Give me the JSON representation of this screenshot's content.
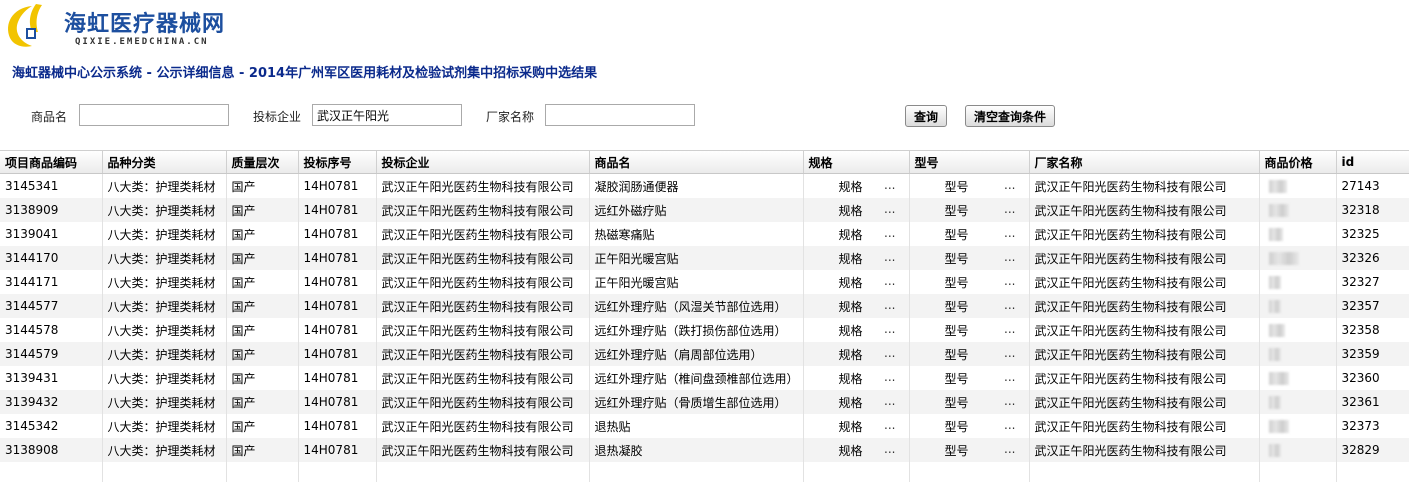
{
  "brand": {
    "name": "海虹医疗器械网",
    "domain": "QIXIE.EMEDCHINA.CN"
  },
  "title": "海虹器械中心公示系统 - 公示详细信息 - 2014年广州军区医用耗材及检验试剂集中招标采购中选结果",
  "search": {
    "product_label": "商品名",
    "product_value": "",
    "bidder_label": "投标企业",
    "bidder_value": "武汉正午阳光",
    "maker_label": "厂家名称",
    "maker_value": "",
    "query_button": "查询",
    "clear_button": "清空查询条件"
  },
  "columns": [
    "项目商品编码",
    "品种分类",
    "质量层次",
    "投标序号",
    "投标企业",
    "商品名",
    "规格",
    "型号",
    "厂家名称",
    "商品价格",
    "id"
  ],
  "spec_label": "规格",
  "model_label": "型号",
  "ellipsis": "...",
  "rows": [
    {
      "code": "3145341",
      "category": "八大类：护理类耗材",
      "quality": "国产",
      "bid_no": "14H0781",
      "bidder": "武汉正午阳光医药生物科技有限公司",
      "product": "凝胶润肠通便器",
      "maker": "武汉正午阳光医药生物科技有限公司",
      "id": "27143"
    },
    {
      "code": "3138909",
      "category": "八大类：护理类耗材",
      "quality": "国产",
      "bid_no": "14H0781",
      "bidder": "武汉正午阳光医药生物科技有限公司",
      "product": "远红外磁疗贴",
      "maker": "武汉正午阳光医药生物科技有限公司",
      "id": "32318"
    },
    {
      "code": "3139041",
      "category": "八大类：护理类耗材",
      "quality": "国产",
      "bid_no": "14H0781",
      "bidder": "武汉正午阳光医药生物科技有限公司",
      "product": "热磁寒痛贴",
      "maker": "武汉正午阳光医药生物科技有限公司",
      "id": "32325"
    },
    {
      "code": "3144170",
      "category": "八大类：护理类耗材",
      "quality": "国产",
      "bid_no": "14H0781",
      "bidder": "武汉正午阳光医药生物科技有限公司",
      "product": "正午阳光暖宫贴",
      "maker": "武汉正午阳光医药生物科技有限公司",
      "id": "32326"
    },
    {
      "code": "3144171",
      "category": "八大类：护理类耗材",
      "quality": "国产",
      "bid_no": "14H0781",
      "bidder": "武汉正午阳光医药生物科技有限公司",
      "product": "正午阳光暖宫贴",
      "maker": "武汉正午阳光医药生物科技有限公司",
      "id": "32327"
    },
    {
      "code": "3144577",
      "category": "八大类：护理类耗材",
      "quality": "国产",
      "bid_no": "14H0781",
      "bidder": "武汉正午阳光医药生物科技有限公司",
      "product": "远红外理疗贴（风湿关节部位选用）",
      "maker": "武汉正午阳光医药生物科技有限公司",
      "id": "32357"
    },
    {
      "code": "3144578",
      "category": "八大类：护理类耗材",
      "quality": "国产",
      "bid_no": "14H0781",
      "bidder": "武汉正午阳光医药生物科技有限公司",
      "product": "远红外理疗贴（跌打损伤部位选用）",
      "maker": "武汉正午阳光医药生物科技有限公司",
      "id": "32358"
    },
    {
      "code": "3144579",
      "category": "八大类：护理类耗材",
      "quality": "国产",
      "bid_no": "14H0781",
      "bidder": "武汉正午阳光医药生物科技有限公司",
      "product": "远红外理疗贴（肩周部位选用）",
      "maker": "武汉正午阳光医药生物科技有限公司",
      "id": "32359"
    },
    {
      "code": "3139431",
      "category": "八大类：护理类耗材",
      "quality": "国产",
      "bid_no": "14H0781",
      "bidder": "武汉正午阳光医药生物科技有限公司",
      "product": "远红外理疗贴（椎间盘颈椎部位选用）",
      "maker": "武汉正午阳光医药生物科技有限公司",
      "id": "32360"
    },
    {
      "code": "3139432",
      "category": "八大类：护理类耗材",
      "quality": "国产",
      "bid_no": "14H0781",
      "bidder": "武汉正午阳光医药生物科技有限公司",
      "product": "远红外理疗贴（骨质增生部位选用）",
      "maker": "武汉正午阳光医药生物科技有限公司",
      "id": "32361"
    },
    {
      "code": "3145342",
      "category": "八大类：护理类耗材",
      "quality": "国产",
      "bid_no": "14H0781",
      "bidder": "武汉正午阳光医药生物科技有限公司",
      "product": "退热贴",
      "maker": "武汉正午阳光医药生物科技有限公司",
      "id": "32373"
    },
    {
      "code": "3138908",
      "category": "八大类：护理类耗材",
      "quality": "国产",
      "bid_no": "14H0781",
      "bidder": "武汉正午阳光医药生物科技有限公司",
      "product": "退热凝胶",
      "maker": "武汉正午阳光医药生物科技有限公司",
      "id": "32829"
    }
  ],
  "colors": {
    "brand_blue": "#1d4f9f",
    "title_blue": "#0b2a8c",
    "logo_yellow": "#f2c400"
  }
}
